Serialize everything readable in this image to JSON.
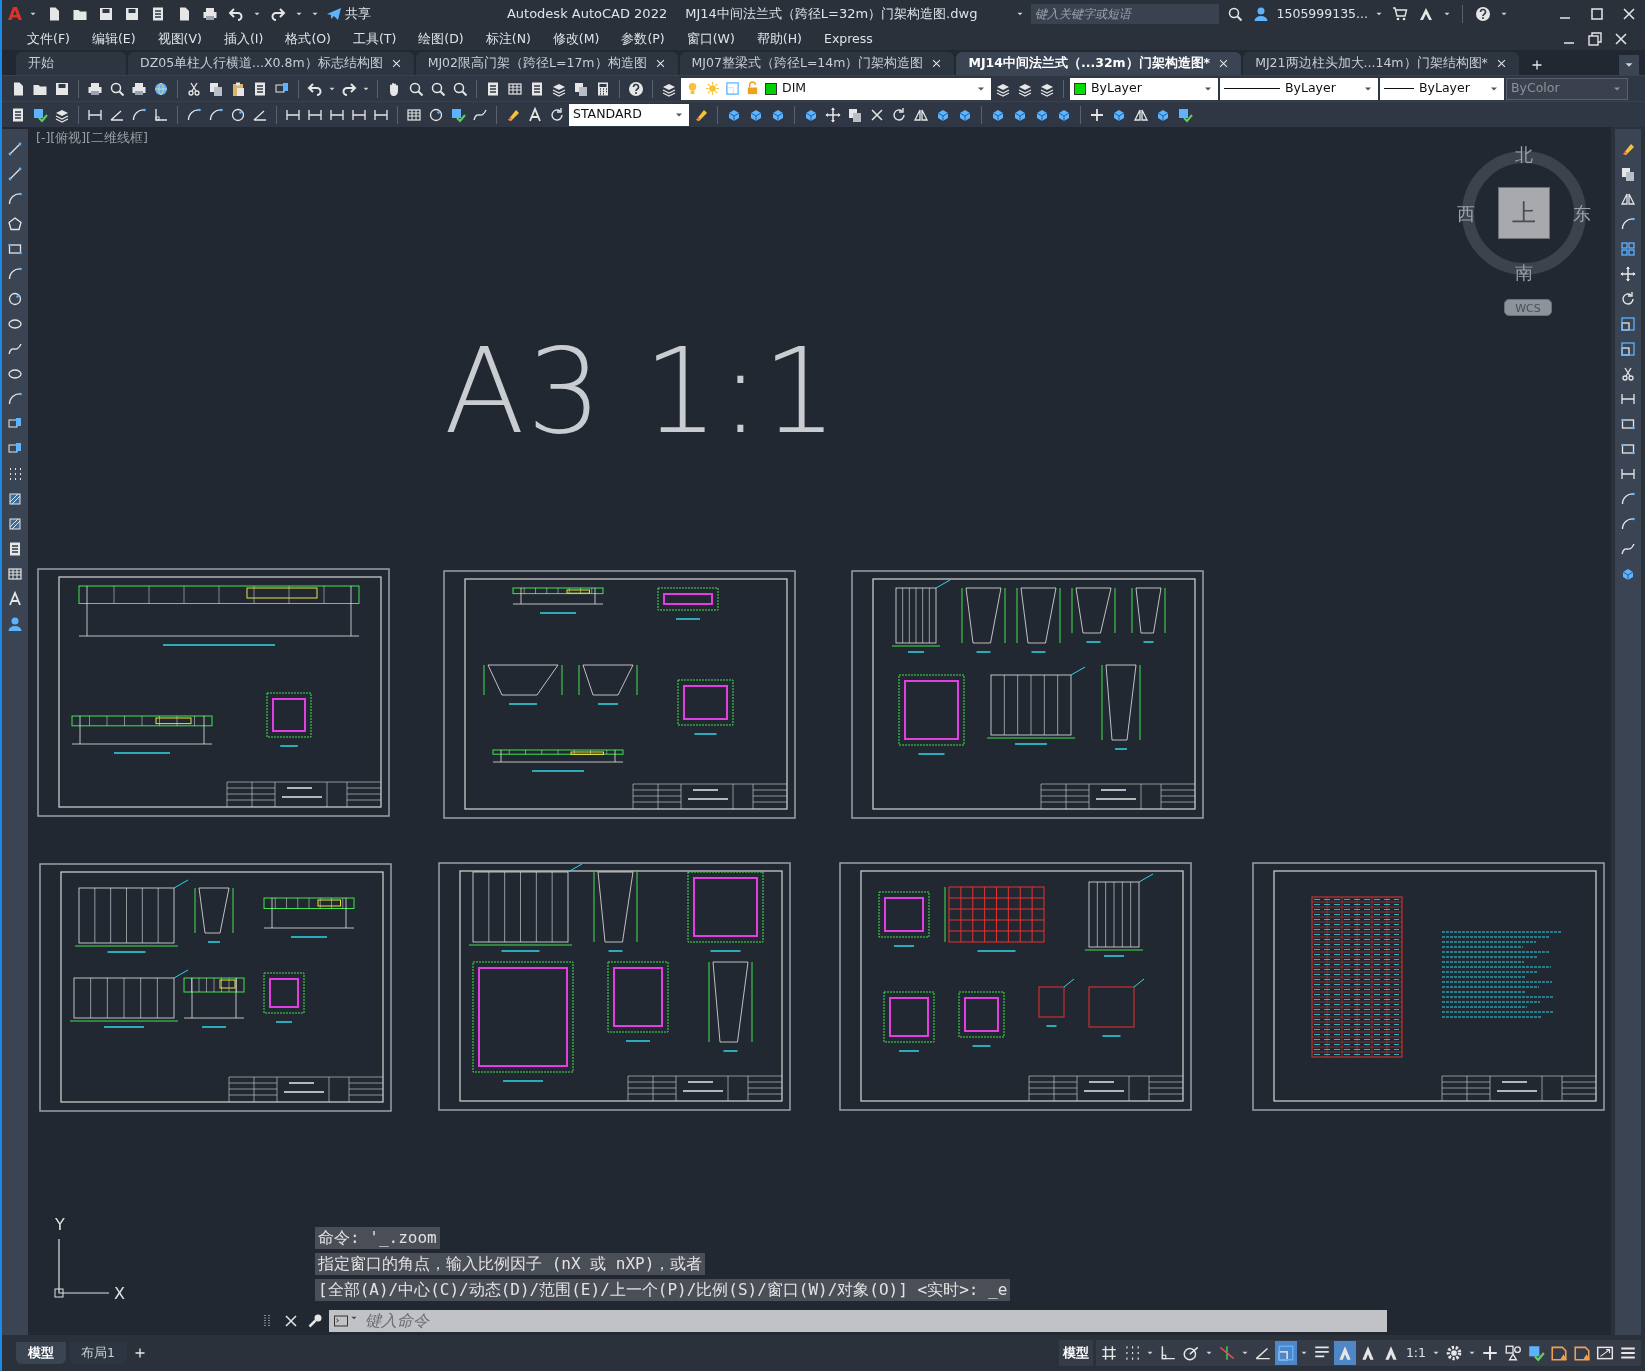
{
  "title_bar": {
    "logo": "A",
    "share": "共享",
    "app_title": "Autodesk AutoCAD 2022",
    "file_name": "MJ14中间法兰式（跨径L=32m）门架构造图.dwg",
    "search": {
      "placeholder": "键入关键字或短语"
    },
    "user": "1505999135..."
  },
  "menu": [
    "文件(F)",
    "编辑(E)",
    "视图(V)",
    "插入(I)",
    "格式(O)",
    "工具(T)",
    "绘图(D)",
    "标注(N)",
    "修改(M)",
    "参数(P)",
    "窗口(W)",
    "帮助(H)",
    "Express"
  ],
  "tabs": [
    {
      "label": "开始",
      "selected": false,
      "closable": false
    },
    {
      "label": "DZ05单柱人行横道...X0.8m）标志结构图",
      "selected": false,
      "closable": true
    },
    {
      "label": "MJ02限高门架（跨径L=17m）构造图",
      "selected": false,
      "closable": true
    },
    {
      "label": "MJ07整梁式（跨径L=14m）门架构造图",
      "selected": false,
      "closable": true
    },
    {
      "label": "MJ14中间法兰式（...32m）门架构造图*",
      "selected": true,
      "closable": true
    },
    {
      "label": "MJ21两边柱头加大...14m）门架结构图*",
      "selected": false,
      "closable": true
    }
  ],
  "toolbar": {
    "layer": "DIM",
    "color_setting": "ByLayer",
    "linetype": "ByLayer",
    "lineweight": "ByLayer",
    "plot_style": {
      "value": "ByColor",
      "disabled": true
    },
    "text_style": "STANDARD"
  },
  "viewport": {
    "label": "[-][俯视][二维线框]",
    "title_text": "A3 1:1"
  },
  "viewcube": {
    "north": "北",
    "east": "东",
    "south": "南",
    "west": "西",
    "face": "上",
    "ucs": "WCS"
  },
  "ucs_icon": {
    "y": "Y",
    "x": "X"
  },
  "command_line": {
    "history": [
      "命令: '_.zoom",
      "指定窗口的角点，输入比例因子 (nX 或 nXP)，或者",
      "[全部(A)/中心(C)/动态(D)/范围(E)/上一个(P)/比例(S)/窗口(W)/对象(O)] <实时>: _e"
    ],
    "placeholder": "键入命令"
  },
  "layout_tabs": [
    {
      "label": "模型",
      "selected": true
    },
    {
      "label": "布局1",
      "selected": false
    }
  ],
  "status_bar": {
    "model": "模型",
    "scale": "1:1",
    "toggles": [
      {
        "on": false
      },
      {
        "on": false
      },
      {
        "on": false
      },
      {
        "on": false
      },
      {
        "on": false
      },
      {
        "on": false
      },
      {
        "on": true
      },
      {
        "on": false
      },
      {
        "on": true
      },
      {
        "on": false
      },
      {
        "on": false
      },
      {
        "on": false
      },
      {
        "on": false
      },
      {
        "on": false
      },
      {
        "on": false
      },
      {
        "on": false
      },
      {
        "on": false
      },
      {
        "on": false
      },
      {
        "on": false
      }
    ]
  }
}
